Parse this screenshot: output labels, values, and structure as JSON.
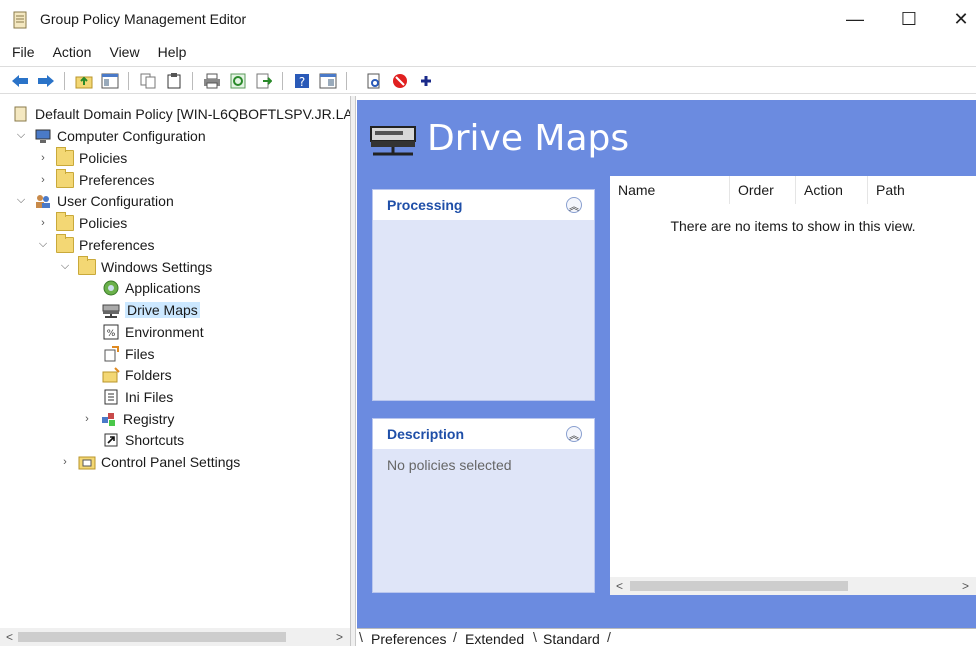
{
  "window": {
    "title": "Group Policy Management Editor",
    "min_glyph": "—",
    "max_glyph": "☐",
    "close_glyph": "✕"
  },
  "menu": [
    "File",
    "Action",
    "View",
    "Help"
  ],
  "tree": {
    "root": "Default Domain Policy [WIN-L6QBOFTLSPV.JR.LA",
    "computer_config": "Computer Configuration",
    "cc_policies": "Policies",
    "cc_preferences": "Preferences",
    "user_config": "User Configuration",
    "uc_policies": "Policies",
    "uc_preferences": "Preferences",
    "windows_settings": "Windows Settings",
    "applications": "Applications",
    "drive_maps": "Drive Maps",
    "environment": "Environment",
    "files": "Files",
    "folders": "Folders",
    "ini_files": "Ini Files",
    "registry": "Registry",
    "shortcuts": "Shortcuts",
    "control_panel": "Control Panel Settings"
  },
  "right": {
    "title": "Drive Maps",
    "processing_label": "Processing",
    "description_label": "Description",
    "description_text": "No policies selected",
    "columns": [
      "Name",
      "Order",
      "Action",
      "Path"
    ],
    "empty_text": "There are no items to show in this view."
  },
  "tabs": [
    "Preferences",
    "Extended",
    "Standard"
  ],
  "colors": {
    "pane_bg": "#6b8be0",
    "panel_header_text": "#1f4fa8",
    "selection": "#cce8ff"
  }
}
